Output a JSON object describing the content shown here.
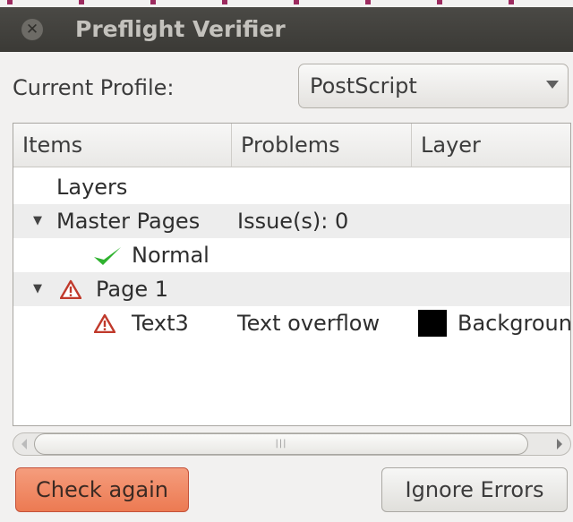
{
  "window": {
    "title": "Preflight Verifier",
    "close_glyph": "✕"
  },
  "profile": {
    "label": "Current Profile:",
    "value": "PostScript"
  },
  "columns": {
    "items": "Items",
    "problems": "Problems",
    "layer": "Layer"
  },
  "rows": [
    {
      "item": "Layers",
      "problems": "",
      "layer": ""
    },
    {
      "item": "Master Pages",
      "problems": "Issue(s): 0",
      "layer": "",
      "expander": "▼"
    },
    {
      "item": "Normal",
      "problems": "",
      "layer": "",
      "icon": "checkmark-icon"
    },
    {
      "item": "Page 1",
      "problems": "",
      "layer": "",
      "expander": "▼",
      "icon": "warning-icon"
    },
    {
      "item": "Text3",
      "problems": "Text overflow",
      "layer": "Background",
      "icon": "warning-icon",
      "swatch_color": "#000000"
    }
  ],
  "scrollbar": {
    "grip": "|||"
  },
  "buttons": {
    "check_again": "Check again",
    "ignore_errors": "Ignore Errors"
  },
  "colors": {
    "accent_button": "#ec7a52",
    "warning": "#c0392b",
    "check": "#2fb22f"
  }
}
